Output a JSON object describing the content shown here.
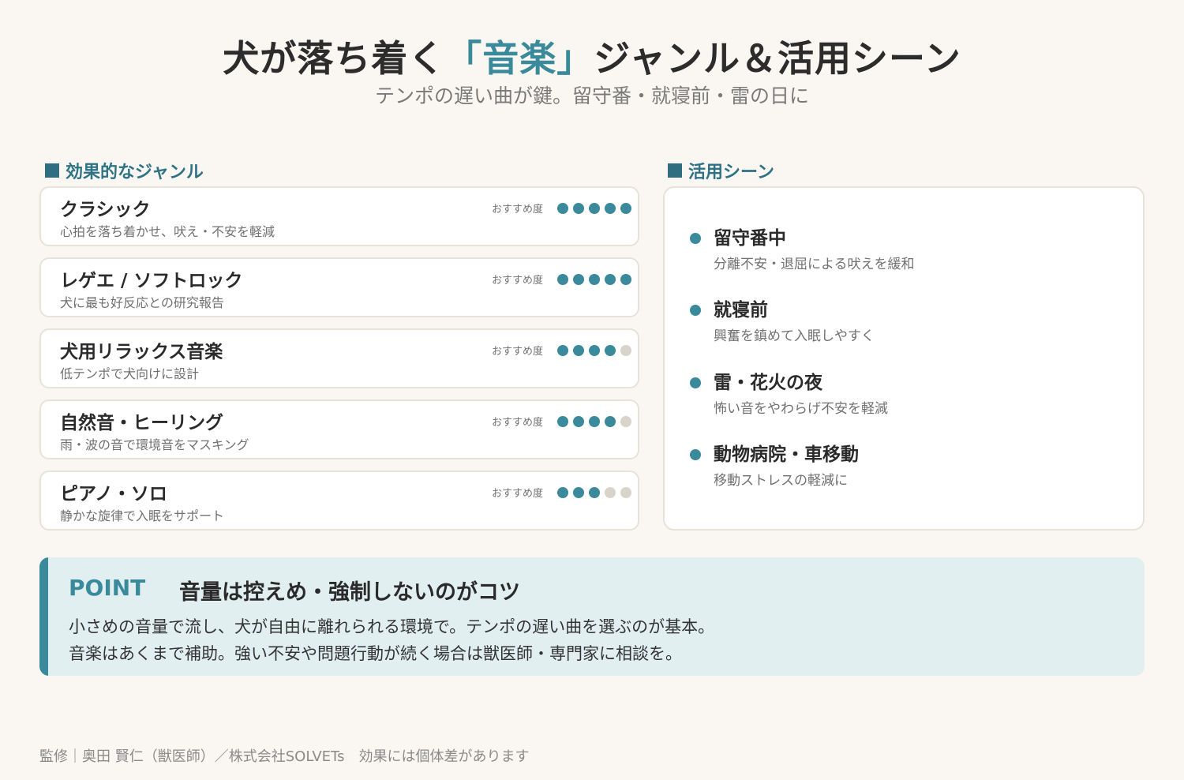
{
  "header": {
    "title_pre": "犬が落ち着く",
    "title_accent": "「音楽」",
    "title_post": "ジャンル＆活用シーン",
    "subtitle": "テンポの遅い曲が鍵。留守番・就寝前・雷の日に"
  },
  "genres_section": {
    "label": "効果的なジャンル",
    "rating_label": "おすすめ度",
    "items": [
      {
        "name": "クラシック",
        "desc": "心拍を落ち着かせ、吠え・不安を軽減",
        "rating": 5
      },
      {
        "name": "レゲエ / ソフトロック",
        "desc": "犬に最も好反応との研究報告",
        "rating": 5
      },
      {
        "name": "犬用リラックス音楽",
        "desc": "低テンポで犬向けに設計",
        "rating": 4
      },
      {
        "name": "自然音・ヒーリング",
        "desc": "雨・波の音で環境音をマスキング",
        "rating": 4
      },
      {
        "name": "ピアノ・ソロ",
        "desc": "静かな旋律で入眠をサポート",
        "rating": 3
      }
    ],
    "rating_max": 5
  },
  "scenes_section": {
    "label": "活用シーン",
    "items": [
      {
        "title": "留守番中",
        "desc": "分離不安・退屈による吠えを緩和"
      },
      {
        "title": "就寝前",
        "desc": "興奮を鎮めて入眠しやすく"
      },
      {
        "title": "雷・花火の夜",
        "desc": "怖い音をやわらげ不安を軽減"
      },
      {
        "title": "動物病院・車移動",
        "desc": "移動ストレスの軽減に"
      }
    ]
  },
  "point": {
    "label": "POINT",
    "heading": "音量は控えめ・強制しないのがコツ",
    "line1": "小さめの音量で流し、犬が自由に離れられる環境で。テンポの遅い曲を選ぶのが基本。",
    "line2": "音楽はあくまで補助。強い不安や問題行動が続く場合は獣医師・専門家に相談を。"
  },
  "footer": {
    "text": "監修｜奥田 賢仁（獣医師）／株式会社SOLVETs　効果には個体差があります"
  },
  "colors": {
    "accent": "#3a8a9c",
    "section": "#2e7285",
    "background": "#faf7f2",
    "point_bg": "#e2eff1",
    "dot_off": "#d9d4cb"
  }
}
